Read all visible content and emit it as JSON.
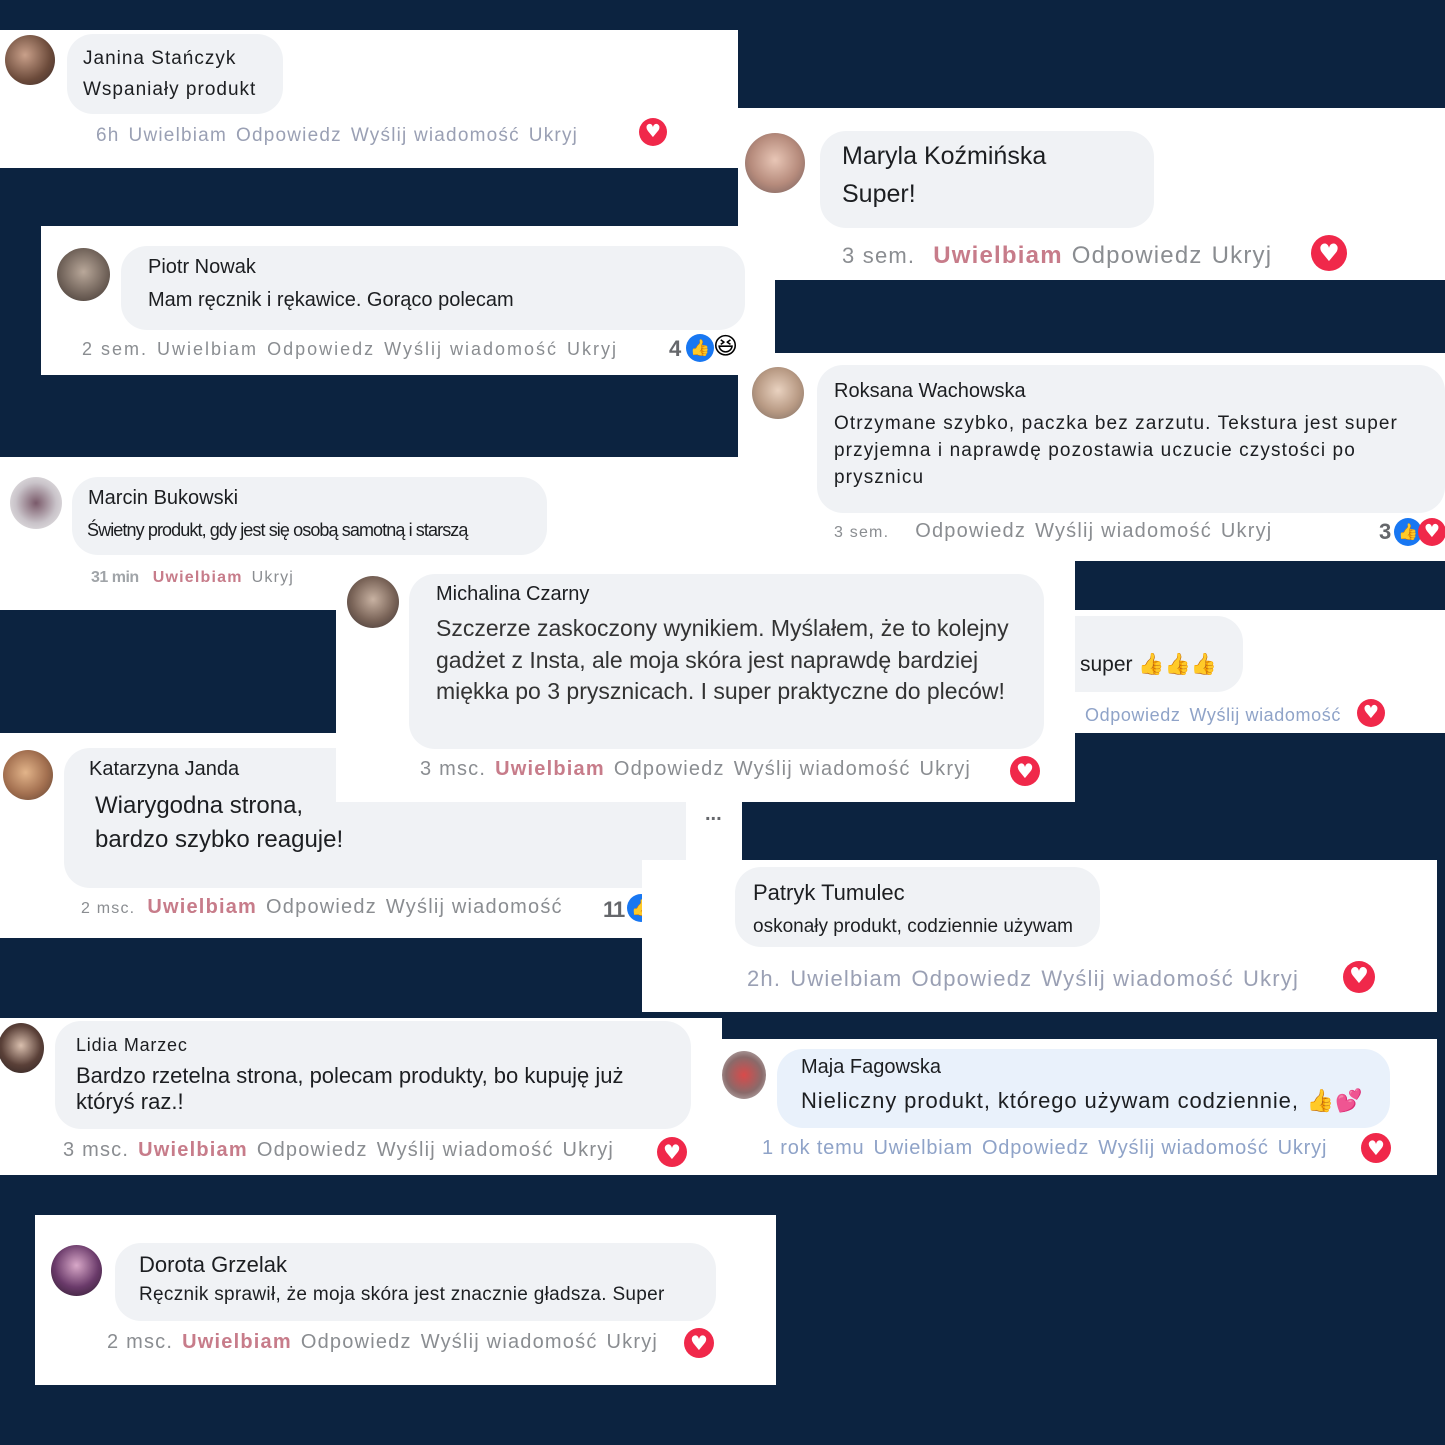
{
  "comments": {
    "janina": {
      "name": "Janina Stańczyk",
      "text": "Wspaniały produkt",
      "time": "6h",
      "love": "Uwielbiam",
      "reply": "Odpowiedz",
      "message": "Wyślij wiadomość",
      "hide": "Ukryj"
    },
    "maryla": {
      "name": "Maryla Koźmińska",
      "text": "Super!",
      "time": "3 sem.",
      "love": "Uwielbiam",
      "reply": "Odpowiedz",
      "hide": "Ukryj"
    },
    "piotr": {
      "name": "Piotr Nowak",
      "text": "Mam ręcznik i rękawice. Gorąco polecam",
      "time": "2 sem.",
      "love": "Uwielbiam",
      "reply": "Odpowiedz",
      "message": "Wyślij wiadomość",
      "hide": "Ukryj",
      "reactions": "4"
    },
    "roksana": {
      "name": "Roksana Wachowska",
      "text": "Otrzymane szybko, paczka bez zarzutu. Tekstura jest super przyjemna i naprawdę pozostawia uczucie czystości po prysznicu",
      "time": "3 sem.",
      "reply": "Odpowiedz",
      "message": "Wyślij wiadomość",
      "hide": "Ukryj",
      "reactions": "3"
    },
    "marcin": {
      "name": "Marcin Bukowski",
      "text": "Świetny produkt, gdy jest się osobą samotną i starszą",
      "time": "31 min",
      "love": "Uwielbiam",
      "hide": "Ukryj"
    },
    "michalina": {
      "name": "Michalina Czarny",
      "text": "Szczerze zaskoczony wynikiem. Myślałem, że to kolejny gadżet z Insta, ale moja skóra jest naprawdę bardziej miękka po 3 prysznicach. I super praktyczne do pleców!",
      "time": "3 msc.",
      "love": "Uwielbiam",
      "reply": "Odpowiedz",
      "message": "Wyślij wiadomość",
      "hide": "Ukryj"
    },
    "super": {
      "text": "super",
      "reply": "Odpowiedz",
      "message": "Wyślij wiadomość"
    },
    "katarzyna": {
      "name": "Katarzyna Janda",
      "text": "Wiarygodna strona, bardzo szybko reaguje!",
      "time": "2 msc.",
      "love": "Uwielbiam",
      "reply": "Odpowiedz",
      "message": "Wyślij wiadomość",
      "reactions": "11",
      "more": "..."
    },
    "patryk": {
      "name": "Patryk Tumulec",
      "text": "oskonały produkt, codziennie używam",
      "time": "2h.",
      "love": "Uwielbiam",
      "reply": "Odpowiedz",
      "message": "Wyślij wiadomość",
      "hide": "Ukryj"
    },
    "lidia": {
      "name": "Lidia Marzec",
      "text": "Bardzo rzetelna strona, polecam produkty, bo kupuję już któryś raz.!",
      "time": "3 msc.",
      "love": "Uwielbiam",
      "reply": "Odpowiedz",
      "message": "Wyślij wiadomość",
      "hide": "Ukryj"
    },
    "maja": {
      "name": "Maja Fagowska",
      "text": "Nieliczny produkt, którego używam codziennie,",
      "time": "1 rok temu",
      "love": "Uwielbiam",
      "reply": "Odpowiedz",
      "message": "Wyślij wiadomość",
      "hide": "Ukryj"
    },
    "dorota": {
      "name": "Dorota Grzelak",
      "text": "Ręcznik sprawił, że moja skóra jest znacznie gładsza. Super",
      "time": "2 msc.",
      "love": "Uwielbiam",
      "reply": "Odpowiedz",
      "message": "Wyślij wiadomość",
      "hide": "Ukryj"
    }
  },
  "colors": {
    "background": "#0c2340",
    "card": "#ffffff",
    "bubble": "#f0f2f5",
    "love": "#c77c8a",
    "meta": "#8a8d91",
    "heart": "#f0284a",
    "like": "#1877f2"
  }
}
